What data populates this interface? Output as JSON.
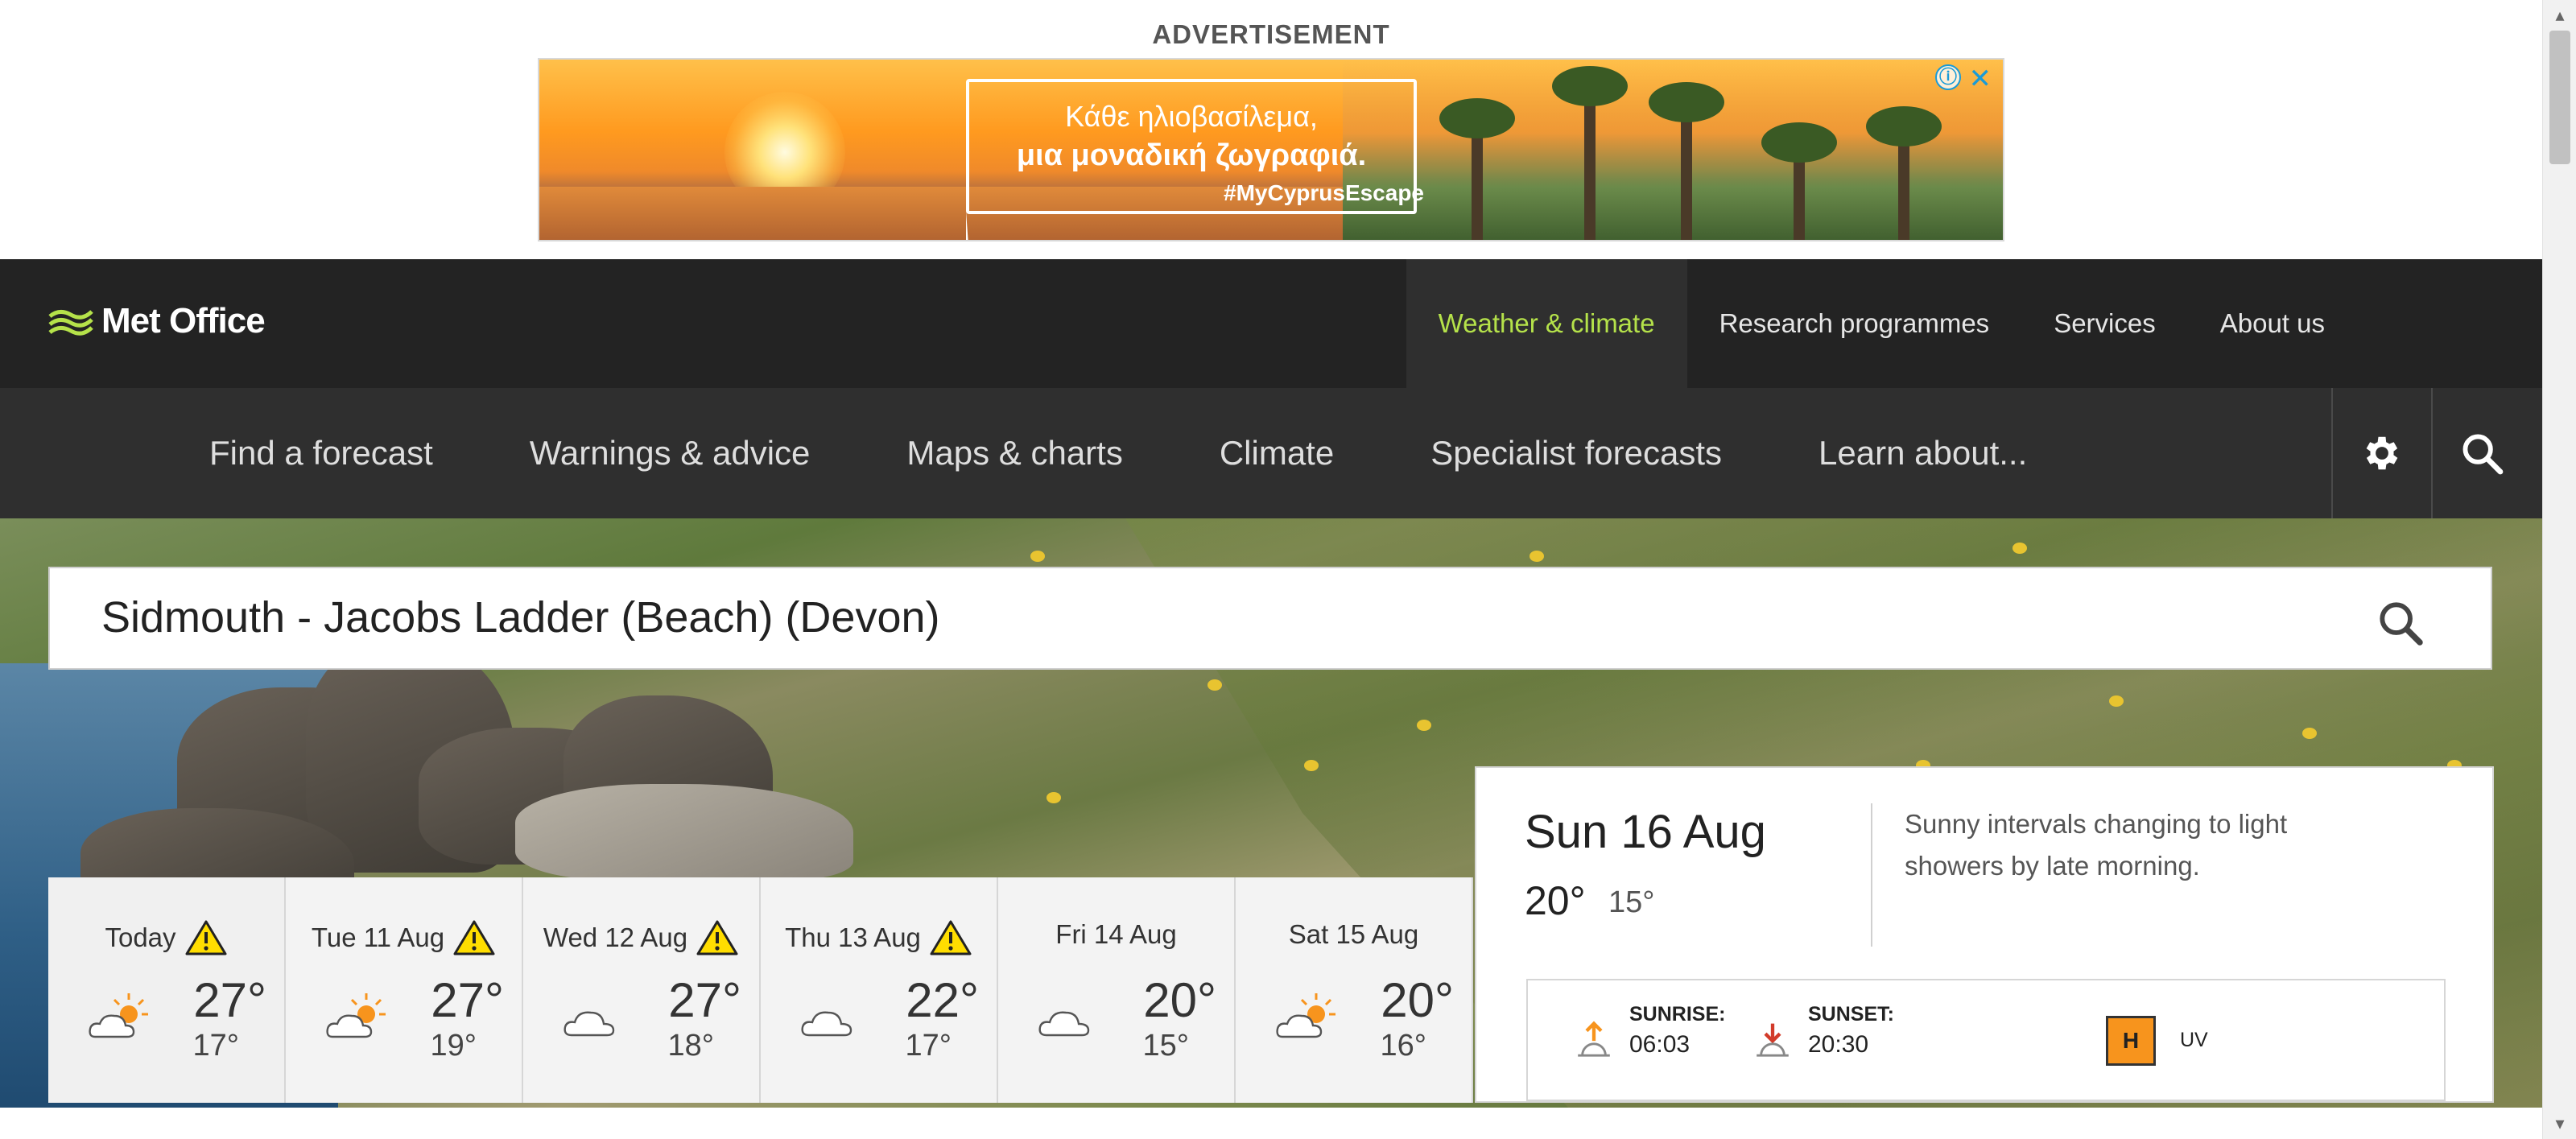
{
  "advertisement": {
    "label": "ADVERTISEMENT",
    "headline_line1": "Κάθε ηλιοβασίλεμα,",
    "headline_line2": "μια μοναδική ζωγραφιά.",
    "hashtag": "#MyCyprusEscape",
    "info_icon": "ⓘ",
    "close_icon": "✕"
  },
  "brand": {
    "name": "Met Office",
    "accent": "#b5e24a"
  },
  "top_nav": [
    {
      "label": "Weather & climate",
      "active": true
    },
    {
      "label": "Research programmes",
      "active": false
    },
    {
      "label": "Services",
      "active": false
    },
    {
      "label": "About us",
      "active": false
    }
  ],
  "sub_nav": [
    {
      "label": "Find a forecast"
    },
    {
      "label": "Warnings & advice"
    },
    {
      "label": "Maps & charts"
    },
    {
      "label": "Climate"
    },
    {
      "label": "Specialist forecasts"
    },
    {
      "label": "Learn about..."
    }
  ],
  "icons": {
    "settings": "gear-icon",
    "search": "search-icon"
  },
  "location_search": {
    "value": "Sidmouth - Jacobs Ladder (Beach) (Devon)"
  },
  "forecast_days": [
    {
      "label": "Today",
      "warning": true,
      "icon": "sunny-intervals-icon",
      "max": "27°",
      "min": "17°"
    },
    {
      "label": "Tue 11 Aug",
      "warning": true,
      "icon": "sunny-intervals-icon",
      "max": "27°",
      "min": "19°"
    },
    {
      "label": "Wed 12 Aug",
      "warning": true,
      "icon": "cloud-icon",
      "max": "27°",
      "min": "18°"
    },
    {
      "label": "Thu 13 Aug",
      "warning": true,
      "icon": "cloud-icon",
      "max": "22°",
      "min": "17°"
    },
    {
      "label": "Fri 14 Aug",
      "warning": false,
      "icon": "cloud-icon",
      "max": "20°",
      "min": "15°"
    },
    {
      "label": "Sat 15 Aug",
      "warning": false,
      "icon": "sunny-intervals-icon",
      "max": "20°",
      "min": "16°"
    }
  ],
  "detail": {
    "date": "Sun 16 Aug",
    "max": "20°",
    "min": "15°",
    "summary": "Sunny intervals changing to light showers by late morning.",
    "sunrise_label": "SUNRISE:",
    "sunrise_time": "06:03",
    "sunset_label": "SUNSET:",
    "sunset_time": "20:30",
    "uv_value": "H",
    "uv_label": "UV",
    "uv_color": "#f7941d"
  }
}
